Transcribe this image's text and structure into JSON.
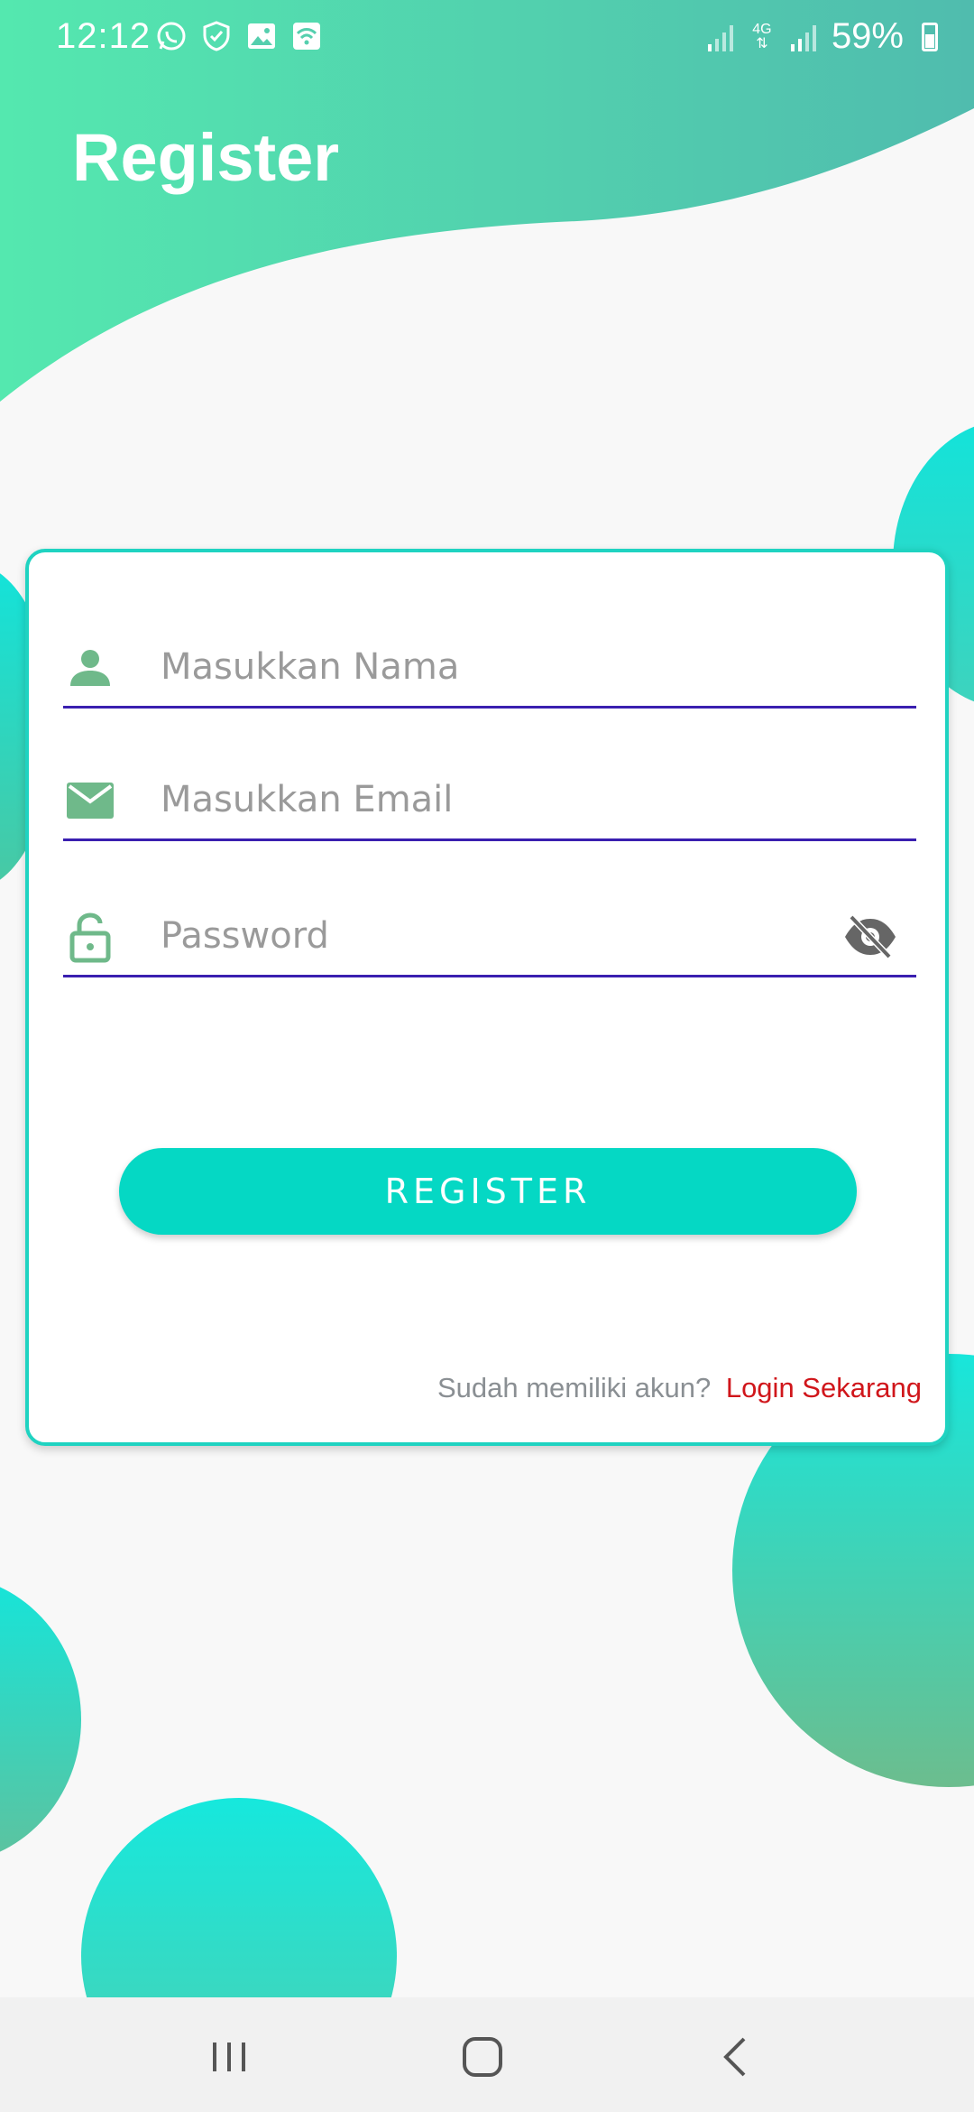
{
  "status_bar": {
    "time": "12:12",
    "network_label": "4G",
    "battery": "59%",
    "left_icons": [
      "whatsapp-icon",
      "shield-icon",
      "gallery-icon",
      "wifi-icon"
    ]
  },
  "header": {
    "title": "Register"
  },
  "form": {
    "name_placeholder": "Masukkan Nama",
    "email_placeholder": "Masukkan Email",
    "password_placeholder": "Password",
    "register_label": "REGISTER",
    "login_prompt": "Sudah memiliki akun?",
    "login_link": "Login Sekarang"
  },
  "colors": {
    "accent": "#05d8c4",
    "field_underline": "#3a1fb0",
    "icon_green": "#6fb98a",
    "link_red": "#d0161b"
  }
}
